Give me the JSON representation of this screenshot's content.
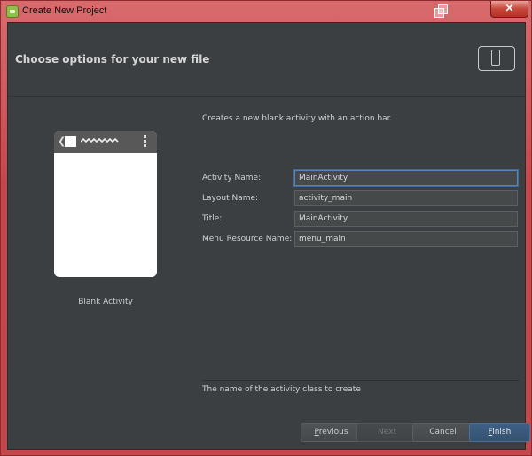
{
  "window": {
    "title": "Create New Project",
    "close_glyph": "✕"
  },
  "header": {
    "title": "Choose options for your new file",
    "icon": "device-icon"
  },
  "preview": {
    "label": "Blank Activity",
    "chevron": "❮"
  },
  "description": "Creates a new blank activity with an action bar.",
  "form": {
    "activity_name": {
      "label": "Activity Name:",
      "value": "MainActivity"
    },
    "layout_name": {
      "label": "Layout Name:",
      "value": "activity_main"
    },
    "title": {
      "label": "Title:",
      "value": "MainActivity"
    },
    "menu_resource_name": {
      "label": "Menu Resource Name:",
      "value": "menu_main"
    }
  },
  "help_text": "The name of the activity class to create",
  "buttons": {
    "previous": {
      "mnemonic": "P",
      "rest": "revious",
      "enabled": true
    },
    "next": {
      "label": "Next",
      "enabled": false
    },
    "cancel": {
      "label": "Cancel",
      "enabled": true
    },
    "finish": {
      "mnemonic": "F",
      "rest": "inish",
      "enabled": true
    }
  },
  "colors": {
    "frame": "#c94a4e",
    "background": "#3c3f41",
    "focus_border": "#5a84b8",
    "primary_button": "#3e5f86"
  }
}
